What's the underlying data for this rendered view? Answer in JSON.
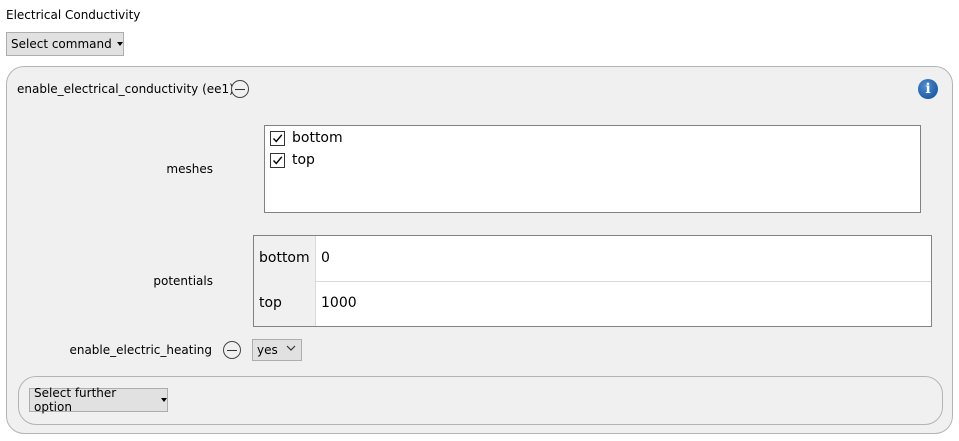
{
  "page": {
    "title": "Electrical Conductivity"
  },
  "toolbar": {
    "select_command_label": "Select command"
  },
  "command": {
    "title": "enable_electrical_conductivity (ee1)",
    "info_icon": "i",
    "meshes": {
      "label": "meshes",
      "items": [
        {
          "label": "bottom",
          "checked": true
        },
        {
          "label": "top",
          "checked": true
        }
      ]
    },
    "potentials": {
      "label": "potentials",
      "rows": [
        {
          "key": "bottom",
          "value": "0"
        },
        {
          "key": "top",
          "value": "1000"
        }
      ]
    },
    "heating": {
      "label": "enable_electric_heating",
      "value": "yes"
    },
    "further_option_label": "Select further option"
  },
  "colors": {
    "panel_bg": "#f0f0f0",
    "button_bg": "#e1e1e1",
    "info_blue": "#1f5ea8"
  },
  "icons": {
    "remove": "minus-circle-icon",
    "info": "info-icon",
    "dropdown": "caret-down-icon",
    "checkbox": "checkmark-icon"
  }
}
